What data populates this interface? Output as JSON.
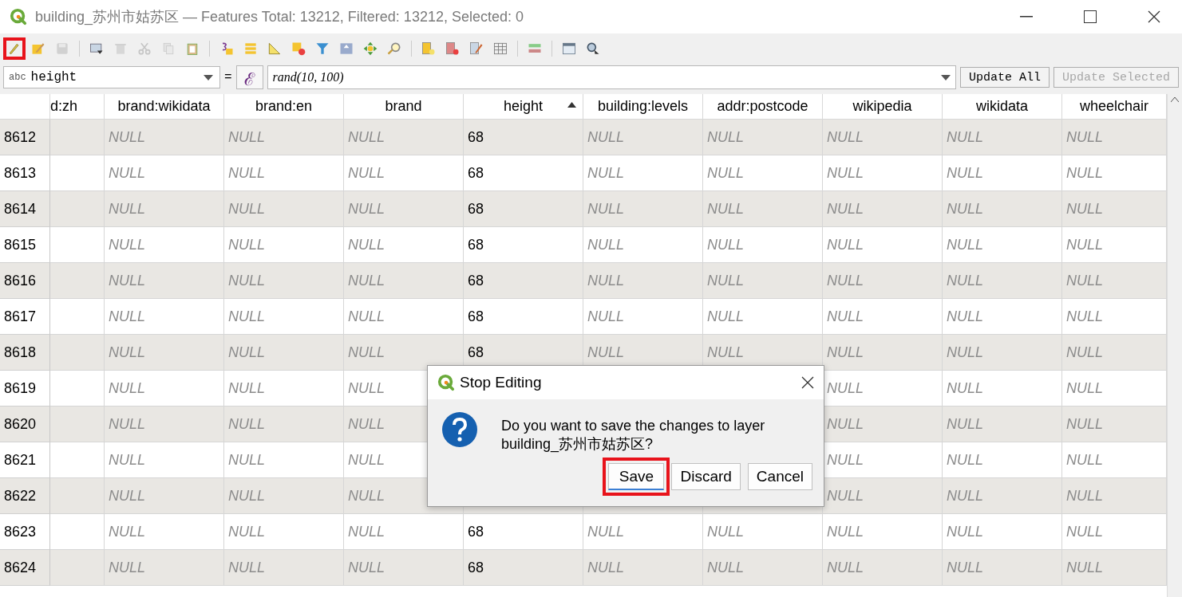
{
  "window": {
    "title": "building_苏州市姑苏区 — Features Total: 13212, Filtered: 13212, Selected: 0"
  },
  "toolbar": [
    {
      "kind": "tool",
      "disabled": false,
      "highlighted": true
    },
    {
      "kind": "tool",
      "disabled": false,
      "highlighted": false
    },
    {
      "kind": "tool",
      "disabled": true,
      "highlighted": false
    },
    {
      "kind": "separator"
    },
    {
      "kind": "tool",
      "disabled": false,
      "highlighted": false
    },
    {
      "kind": "tool",
      "disabled": true,
      "highlighted": false
    },
    {
      "kind": "tool",
      "disabled": true,
      "highlighted": false
    },
    {
      "kind": "tool",
      "disabled": true,
      "highlighted": false
    },
    {
      "kind": "tool",
      "disabled": false,
      "highlighted": false
    },
    {
      "kind": "separator"
    },
    {
      "kind": "tool",
      "disabled": false,
      "highlighted": false
    },
    {
      "kind": "tool",
      "disabled": false,
      "highlighted": false
    },
    {
      "kind": "tool",
      "disabled": false,
      "highlighted": false
    },
    {
      "kind": "tool",
      "disabled": false,
      "highlighted": false
    },
    {
      "kind": "tool",
      "disabled": false,
      "highlighted": false
    },
    {
      "kind": "tool",
      "disabled": false,
      "highlighted": false
    },
    {
      "kind": "tool",
      "disabled": false,
      "highlighted": false
    },
    {
      "kind": "tool",
      "disabled": false,
      "highlighted": false
    },
    {
      "kind": "separator"
    },
    {
      "kind": "tool",
      "disabled": false,
      "highlighted": false
    },
    {
      "kind": "tool",
      "disabled": false,
      "highlighted": false
    },
    {
      "kind": "tool",
      "disabled": false,
      "highlighted": false
    },
    {
      "kind": "tool",
      "disabled": false,
      "highlighted": false
    },
    {
      "kind": "separator"
    },
    {
      "kind": "tool",
      "disabled": false,
      "highlighted": false
    },
    {
      "kind": "separator"
    },
    {
      "kind": "tool",
      "disabled": false,
      "highlighted": false
    },
    {
      "kind": "tool",
      "disabled": false,
      "highlighted": false
    }
  ],
  "field_update": {
    "type_label": "abc",
    "field": "height",
    "equals": "=",
    "expression_button": "ℰ",
    "expression": "rand(10, 100)",
    "buttons": [
      {
        "label": "Update All",
        "disabled": false
      },
      {
        "label": "Update Selected",
        "disabled": true
      }
    ]
  },
  "table": {
    "columns": [
      {
        "label": "d:zh",
        "sorted": false
      },
      {
        "label": "brand:wikidata",
        "sorted": false
      },
      {
        "label": "brand:en",
        "sorted": false
      },
      {
        "label": "brand",
        "sorted": false
      },
      {
        "label": "height",
        "sorted": true
      },
      {
        "label": "building:levels",
        "sorted": false
      },
      {
        "label": "addr:postcode",
        "sorted": false
      },
      {
        "label": "wikipedia",
        "sorted": false
      },
      {
        "label": "wikidata",
        "sorted": false
      },
      {
        "label": "wheelchair",
        "sorted": false
      }
    ],
    "rows": [
      {
        "id": "8612",
        "cells": [
          null,
          "NULL",
          "NULL",
          "NULL",
          "68",
          "NULL",
          "NULL",
          "NULL",
          "NULL",
          "NULL"
        ]
      },
      {
        "id": "8613",
        "cells": [
          null,
          "NULL",
          "NULL",
          "NULL",
          "68",
          "NULL",
          "NULL",
          "NULL",
          "NULL",
          "NULL"
        ]
      },
      {
        "id": "8614",
        "cells": [
          null,
          "NULL",
          "NULL",
          "NULL",
          "68",
          "NULL",
          "NULL",
          "NULL",
          "NULL",
          "NULL"
        ]
      },
      {
        "id": "8615",
        "cells": [
          null,
          "NULL",
          "NULL",
          "NULL",
          "68",
          "NULL",
          "NULL",
          "NULL",
          "NULL",
          "NULL"
        ]
      },
      {
        "id": "8616",
        "cells": [
          null,
          "NULL",
          "NULL",
          "NULL",
          "68",
          "NULL",
          "NULL",
          "NULL",
          "NULL",
          "NULL"
        ]
      },
      {
        "id": "8617",
        "cells": [
          null,
          "NULL",
          "NULL",
          "NULL",
          "68",
          "NULL",
          "NULL",
          "NULL",
          "NULL",
          "NULL"
        ]
      },
      {
        "id": "8618",
        "cells": [
          null,
          "NULL",
          "NULL",
          "NULL",
          "68",
          "NULL",
          "NULL",
          "NULL",
          "NULL",
          "NULL"
        ]
      },
      {
        "id": "8619",
        "cells": [
          null,
          "NULL",
          "NULL",
          "NULL",
          null,
          null,
          null,
          "NULL",
          "NULL",
          "NULL"
        ]
      },
      {
        "id": "8620",
        "cells": [
          null,
          "NULL",
          "NULL",
          "NULL",
          null,
          null,
          null,
          "NULL",
          "NULL",
          "NULL"
        ]
      },
      {
        "id": "8621",
        "cells": [
          null,
          "NULL",
          "NULL",
          "NULL",
          null,
          null,
          null,
          "NULL",
          "NULL",
          "NULL"
        ]
      },
      {
        "id": "8622",
        "cells": [
          null,
          "NULL",
          "NULL",
          "NULL",
          null,
          null,
          null,
          "NULL",
          "NULL",
          "NULL"
        ]
      },
      {
        "id": "8623",
        "cells": [
          null,
          "NULL",
          "NULL",
          "NULL",
          "68",
          "NULL",
          "NULL",
          "NULL",
          "NULL",
          "NULL"
        ]
      },
      {
        "id": "8624",
        "cells": [
          null,
          "NULL",
          "NULL",
          "NULL",
          "68",
          "NULL",
          "NULL",
          "NULL",
          "NULL",
          "NULL"
        ]
      }
    ]
  },
  "dialog": {
    "title": "Stop Editing",
    "message": "Do you want to save the changes to layer building_苏州市姑苏区?",
    "buttons": [
      {
        "label": "Save",
        "highlighted": true
      },
      {
        "label": "Discard",
        "highlighted": false
      },
      {
        "label": "Cancel",
        "highlighted": false
      }
    ]
  }
}
